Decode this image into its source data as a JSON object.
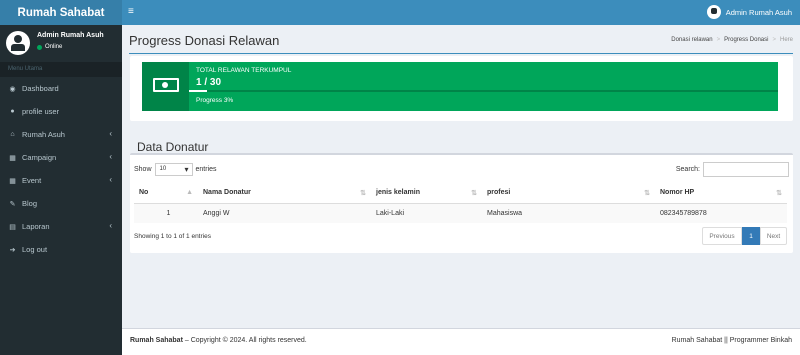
{
  "app": {
    "logo": "Rumah Sahabat"
  },
  "topbar": {
    "user_name": "Admin Rumah Asuh"
  },
  "sidebar": {
    "user_name": "Admin Rumah Asuh",
    "status": "Online",
    "menu_header": "Menu Utama",
    "items": [
      {
        "label": "Dashboard",
        "icon": "dashboard-icon",
        "has_submenu": false
      },
      {
        "label": "profile user",
        "icon": "user-icon",
        "has_submenu": false
      },
      {
        "label": "Rumah Asuh",
        "icon": "home-icon",
        "has_submenu": true
      },
      {
        "label": "Campaign",
        "icon": "calendar-icon",
        "has_submenu": true
      },
      {
        "label": "Event",
        "icon": "calendar-icon",
        "has_submenu": true
      },
      {
        "label": "Blog",
        "icon": "edit-icon",
        "has_submenu": false
      },
      {
        "label": "Laporan",
        "icon": "book-icon",
        "has_submenu": true
      },
      {
        "label": "Log out",
        "icon": "sign-out-icon",
        "has_submenu": false
      }
    ]
  },
  "page": {
    "title": "Progress Donasi Relawan",
    "breadcrumb": [
      "Donasi relawan",
      "Progress Donasi",
      "Here"
    ]
  },
  "info_box": {
    "label": "TOTAL RELAWAN TERKUMPUL",
    "number": "1 / 30",
    "progress_percent": 3,
    "progress_text": "Progress 3%",
    "color": "#00a65a"
  },
  "donatur": {
    "title": "Data Donatur",
    "show_label": "Show",
    "entries_value": "10",
    "entries_label": "entries",
    "search_label": "Search:",
    "columns": [
      "No",
      "Nama Donatur",
      "jenis kelamin",
      "profesi",
      "Nomor HP"
    ],
    "rows": [
      [
        "1",
        "Anggi W",
        "Laki-Laki",
        "Mahasiswa",
        "082345789878"
      ]
    ],
    "info": "Showing 1 to 1 of 1 entries",
    "pagination": {
      "previous": "Previous",
      "current": "1",
      "next": "Next"
    }
  },
  "footer": {
    "brand": "Rumah Sahabat",
    "copyright": "– Copyright © 2024. All rights reserved.",
    "right": "Rumah Sahabat || Programmer Binkah"
  },
  "colors": {
    "header": "#3c8dbc",
    "logo_bg": "#367fa9",
    "sidebar": "#222d32",
    "accent": "#337ab7"
  }
}
